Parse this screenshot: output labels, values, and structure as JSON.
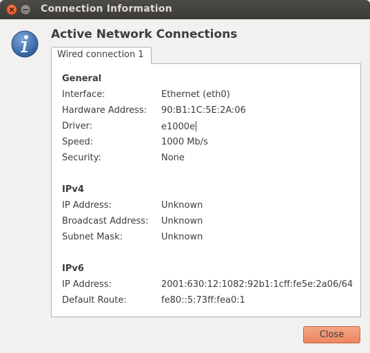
{
  "window": {
    "title": "Connection Information"
  },
  "icons": {
    "info": "info-icon",
    "close": "close-icon",
    "minimize": "minimize-icon"
  },
  "heading": "Active Network Connections",
  "tab": {
    "label": "Wired connection 1"
  },
  "general": {
    "title": "General",
    "rows": [
      {
        "label": "Interface:",
        "value": "Ethernet (eth0)"
      },
      {
        "label": "Hardware Address:",
        "value": "90:B1:1C:5E:2A:06"
      },
      {
        "label": "Driver:",
        "value": "e1000e"
      },
      {
        "label": "Speed:",
        "value": "1000 Mb/s"
      },
      {
        "label": "Security:",
        "value": "None"
      }
    ]
  },
  "ipv4": {
    "title": "IPv4",
    "rows": [
      {
        "label": "IP Address:",
        "value": "Unknown"
      },
      {
        "label": "Broadcast Address:",
        "value": "Unknown"
      },
      {
        "label": "Subnet Mask:",
        "value": "Unknown"
      }
    ]
  },
  "ipv6": {
    "title": "IPv6",
    "rows": [
      {
        "label": "IP Address:",
        "value": "2001:630:12:1082:92b1:1cff:fe5e:2a06/64"
      },
      {
        "label": "Default Route:",
        "value": "fe80::5:73ff:fea0:1"
      }
    ]
  },
  "buttons": {
    "close_label": "Close"
  },
  "colors": {
    "titlebar": "#3c3b37",
    "close_button_accent": "#ec8660",
    "info_icon_blue": "#3c6ea8"
  }
}
